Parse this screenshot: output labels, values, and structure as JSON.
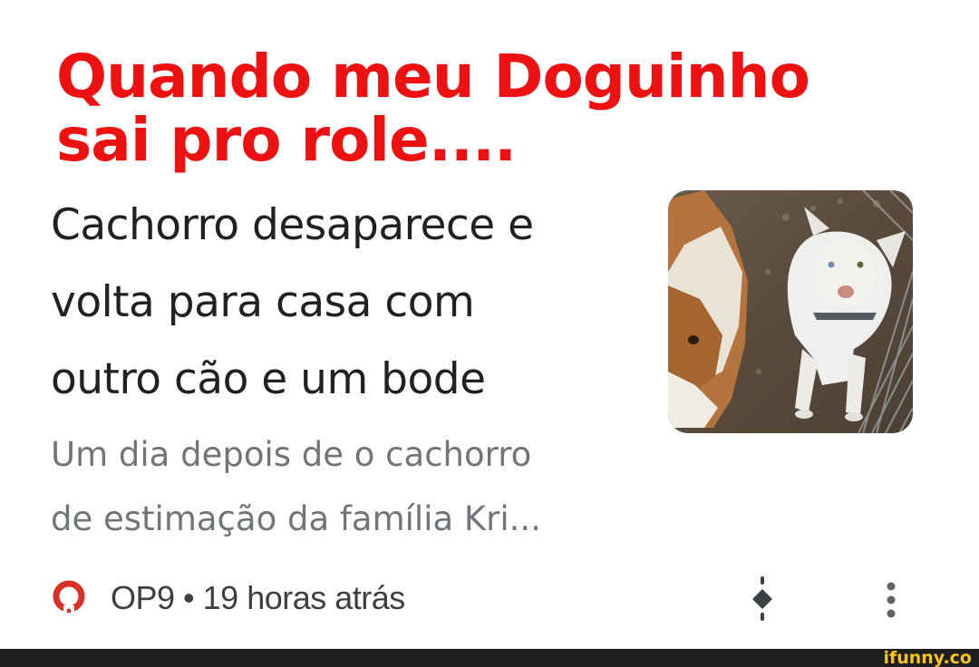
{
  "meme": {
    "caption_line1": "Quando meu Doguinho",
    "caption_line2": "sai pro role....",
    "caption_color": "#ee1111"
  },
  "news_card": {
    "headline_lines": [
      "Cachorro desaparece e",
      "volta para casa com",
      "outro cão e um bode"
    ],
    "snippet_lines": [
      "Um dia depois de o cachorro",
      "de estimação da família Kri..."
    ],
    "thumbnail_icon": "dog-and-goat-photo",
    "source": {
      "icon": "op9-logo-icon",
      "text": "OP9 • 19 horas atrás",
      "icon_color": "#d93025"
    },
    "actions": {
      "brief_icon": "brief-icon",
      "more_icon": "more-vert-icon"
    }
  },
  "watermark": {
    "text": "ifunny.co",
    "color": "#f5c518"
  }
}
